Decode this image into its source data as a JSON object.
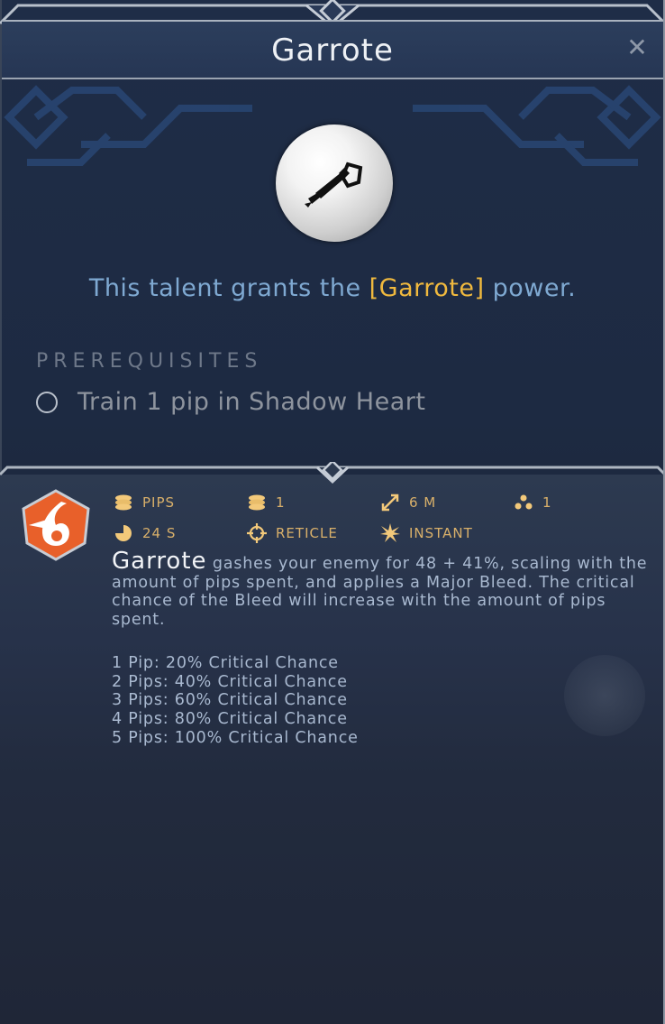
{
  "window": {
    "title": "Garrote",
    "close_icon": "close-icon"
  },
  "talent": {
    "icon": "dagger-icon",
    "grant_prefix": "This talent grants the ",
    "grant_power": "[Garrote]",
    "grant_suffix": " power."
  },
  "prerequisites": {
    "label": "PREREQUISITES",
    "items": [
      {
        "text": "Train 1 pip in Shadow Heart",
        "checked": false
      }
    ]
  },
  "ability": {
    "badge_icon": "bleed-icon",
    "stats": [
      {
        "icon": "coins-icon",
        "label": "PIPS"
      },
      {
        "icon": "coin-stack-icon",
        "label": "1"
      },
      {
        "icon": "range-arrow-icon",
        "label": "6 M"
      },
      {
        "icon": "targets-icon",
        "label": "1"
      },
      {
        "icon": "cooldown-icon",
        "label": "24 S"
      },
      {
        "icon": "reticle-icon",
        "label": "RETICLE"
      },
      {
        "icon": "burst-icon",
        "label": "INSTANT"
      }
    ],
    "name": "Garrote",
    "description": " gashes your enemy for 48 + 41%, scaling with the amount of pips spent, and applies a Major Bleed. The critical chance of the Bleed will increase with the amount of pips spent.",
    "pip_lines": [
      "1 Pip: 20% Critical Chance",
      "2 Pips: 40% Critical Chance",
      "3 Pips: 60% Critical Chance",
      "4 Pips: 80% Critical Chance",
      "5 Pips: 100% Critical Chance"
    ]
  },
  "colors": {
    "accent_gold": "#f0b93e",
    "stat_gold": "#d9b06a",
    "grant_blue": "#7fa9d2",
    "badge_orange": "#e8602a"
  }
}
